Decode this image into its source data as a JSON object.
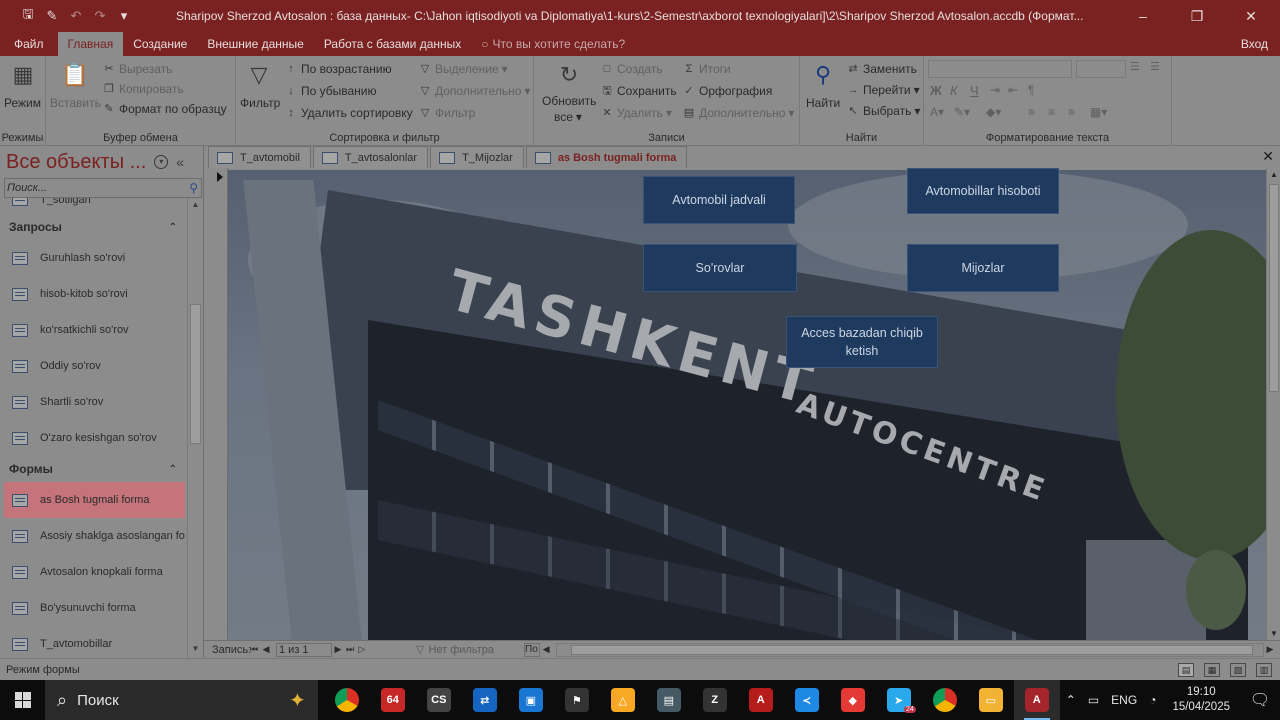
{
  "window": {
    "title": "Sharipov Sherzod Avtosalon : база данных- C:\\Jahon iqtisodiyoti va Diplomatiya\\1-kurs\\2-Semestr\\axborot texnologiyalari]\\2\\Sharipov Sherzod Avtosalon.accdb (Формат..."
  },
  "ribbon_tabs": [
    {
      "label": "Файл"
    },
    {
      "label": "Главная"
    },
    {
      "label": "Создание"
    },
    {
      "label": "Внешние данные"
    },
    {
      "label": "Работа с базами данных"
    }
  ],
  "tell_me": "Что вы хотите сделать?",
  "sign_in": "Вход",
  "ribbon": {
    "views": {
      "mode": "Режим",
      "group": "Режимы"
    },
    "clipboard": {
      "paste": "Вставить",
      "cut": "Вырезать",
      "copy": "Копировать",
      "format_painter": "Формат по образцу",
      "group": "Буфер обмена"
    },
    "sort": {
      "filter": "Фильтр",
      "asc": "По возрастанию",
      "desc": "По убыванию",
      "remove": "Удалить сортировку",
      "selection": "Выделение",
      "advanced": "Дополнительно",
      "toggle": "Фильтр",
      "group": "Сортировка и фильтр"
    },
    "records": {
      "refresh_1": "Обновить",
      "refresh_2": "все",
      "new": "Создать",
      "save": "Сохранить",
      "delete": "Удалить",
      "totals": "Итоги",
      "spelling": "Орфография",
      "more": "Дополнительно",
      "group": "Записи"
    },
    "find": {
      "find": "Найти",
      "replace": "Заменить",
      "goto": "Перейти",
      "select": "Выбрать",
      "group": "Найти"
    },
    "text_format": {
      "bold": "Ж",
      "italic": "К",
      "underline": "Ч",
      "group": "Форматирование текста"
    }
  },
  "nav": {
    "title": "Все объекты ...",
    "search_placeholder": "Поиск...",
    "partial_item": "T_sotilgan",
    "categories": {
      "queries": "Запросы",
      "forms": "Формы"
    },
    "queries": [
      {
        "label": "Guruhlash so'rovi"
      },
      {
        "label": "hisob-kitob so'rovi"
      },
      {
        "label": "ko'rsatkichli so'rov"
      },
      {
        "label": "Oddiy so'rov"
      },
      {
        "label": "Shartli so'rov"
      },
      {
        "label": "O'zaro kesishgan so'rov"
      }
    ],
    "forms": [
      {
        "label": "as Bosh tugmali forma"
      },
      {
        "label": "Asosiy shaklga asoslangan fo..."
      },
      {
        "label": "Avtosalon knopkali forma"
      },
      {
        "label": "Bo'ysunuvchi forma"
      },
      {
        "label": "T_avtomobillar"
      }
    ]
  },
  "doc_tabs": [
    {
      "label": "T_avtomobil"
    },
    {
      "label": "T_avtosalonlar"
    },
    {
      "label": "T_Mijozlar"
    },
    {
      "label": "as Bosh tugmali forma"
    }
  ],
  "form": {
    "sign_line1": "TASHKENT",
    "sign_line2": "AUTOCENTRE",
    "buttons": {
      "cars_table": "Avtomobil jadvali",
      "cars_report": "Avtomobillar hisoboti",
      "queries": "So'rovlar",
      "clients": "Mijozlar",
      "exit": "Acces bazadan chiqib ketish"
    }
  },
  "record_bar": {
    "label": "Запись:",
    "counter": "1 из 1",
    "filter": "Нет фильтра",
    "search": "По"
  },
  "status": {
    "text": "Режим формы"
  },
  "taskbar": {
    "search": "Поиск",
    "apps": [
      {
        "name": "chrome",
        "glyph": "",
        "color": "#2e7d32"
      },
      {
        "name": "64bit",
        "glyph": "64",
        "color": "#c62828"
      },
      {
        "name": "cs",
        "glyph": "CS",
        "color": "#444444"
      },
      {
        "name": "teamviewer",
        "glyph": "⇄",
        "color": "#1565c0"
      },
      {
        "name": "app-blue",
        "glyph": "▣",
        "color": "#1976d2"
      },
      {
        "name": "app-runner",
        "glyph": "⚑",
        "color": "#333333"
      },
      {
        "name": "app-yellow",
        "glyph": "△",
        "color": "#f9a825"
      },
      {
        "name": "save-app",
        "glyph": "▤",
        "color": "#455a64"
      },
      {
        "name": "app-z",
        "glyph": "Z",
        "color": "#333333"
      },
      {
        "name": "acrobat",
        "glyph": "A",
        "color": "#b71c1c"
      },
      {
        "name": "vscode",
        "glyph": "≺",
        "color": "#1e88e5"
      },
      {
        "name": "anydesk",
        "glyph": "◆",
        "color": "#e53935"
      },
      {
        "name": "telegram",
        "glyph": "➤",
        "color": "#29a9eb",
        "badge": "24"
      },
      {
        "name": "chrome-2",
        "glyph": "",
        "color": "#2e7d32"
      },
      {
        "name": "explorer",
        "glyph": "▭",
        "color": "#f2b233"
      },
      {
        "name": "access",
        "glyph": "A",
        "color": "#a4262c",
        "active": true
      }
    ],
    "lang": "ENG",
    "time": "19:10",
    "date": "15/04/2025"
  }
}
